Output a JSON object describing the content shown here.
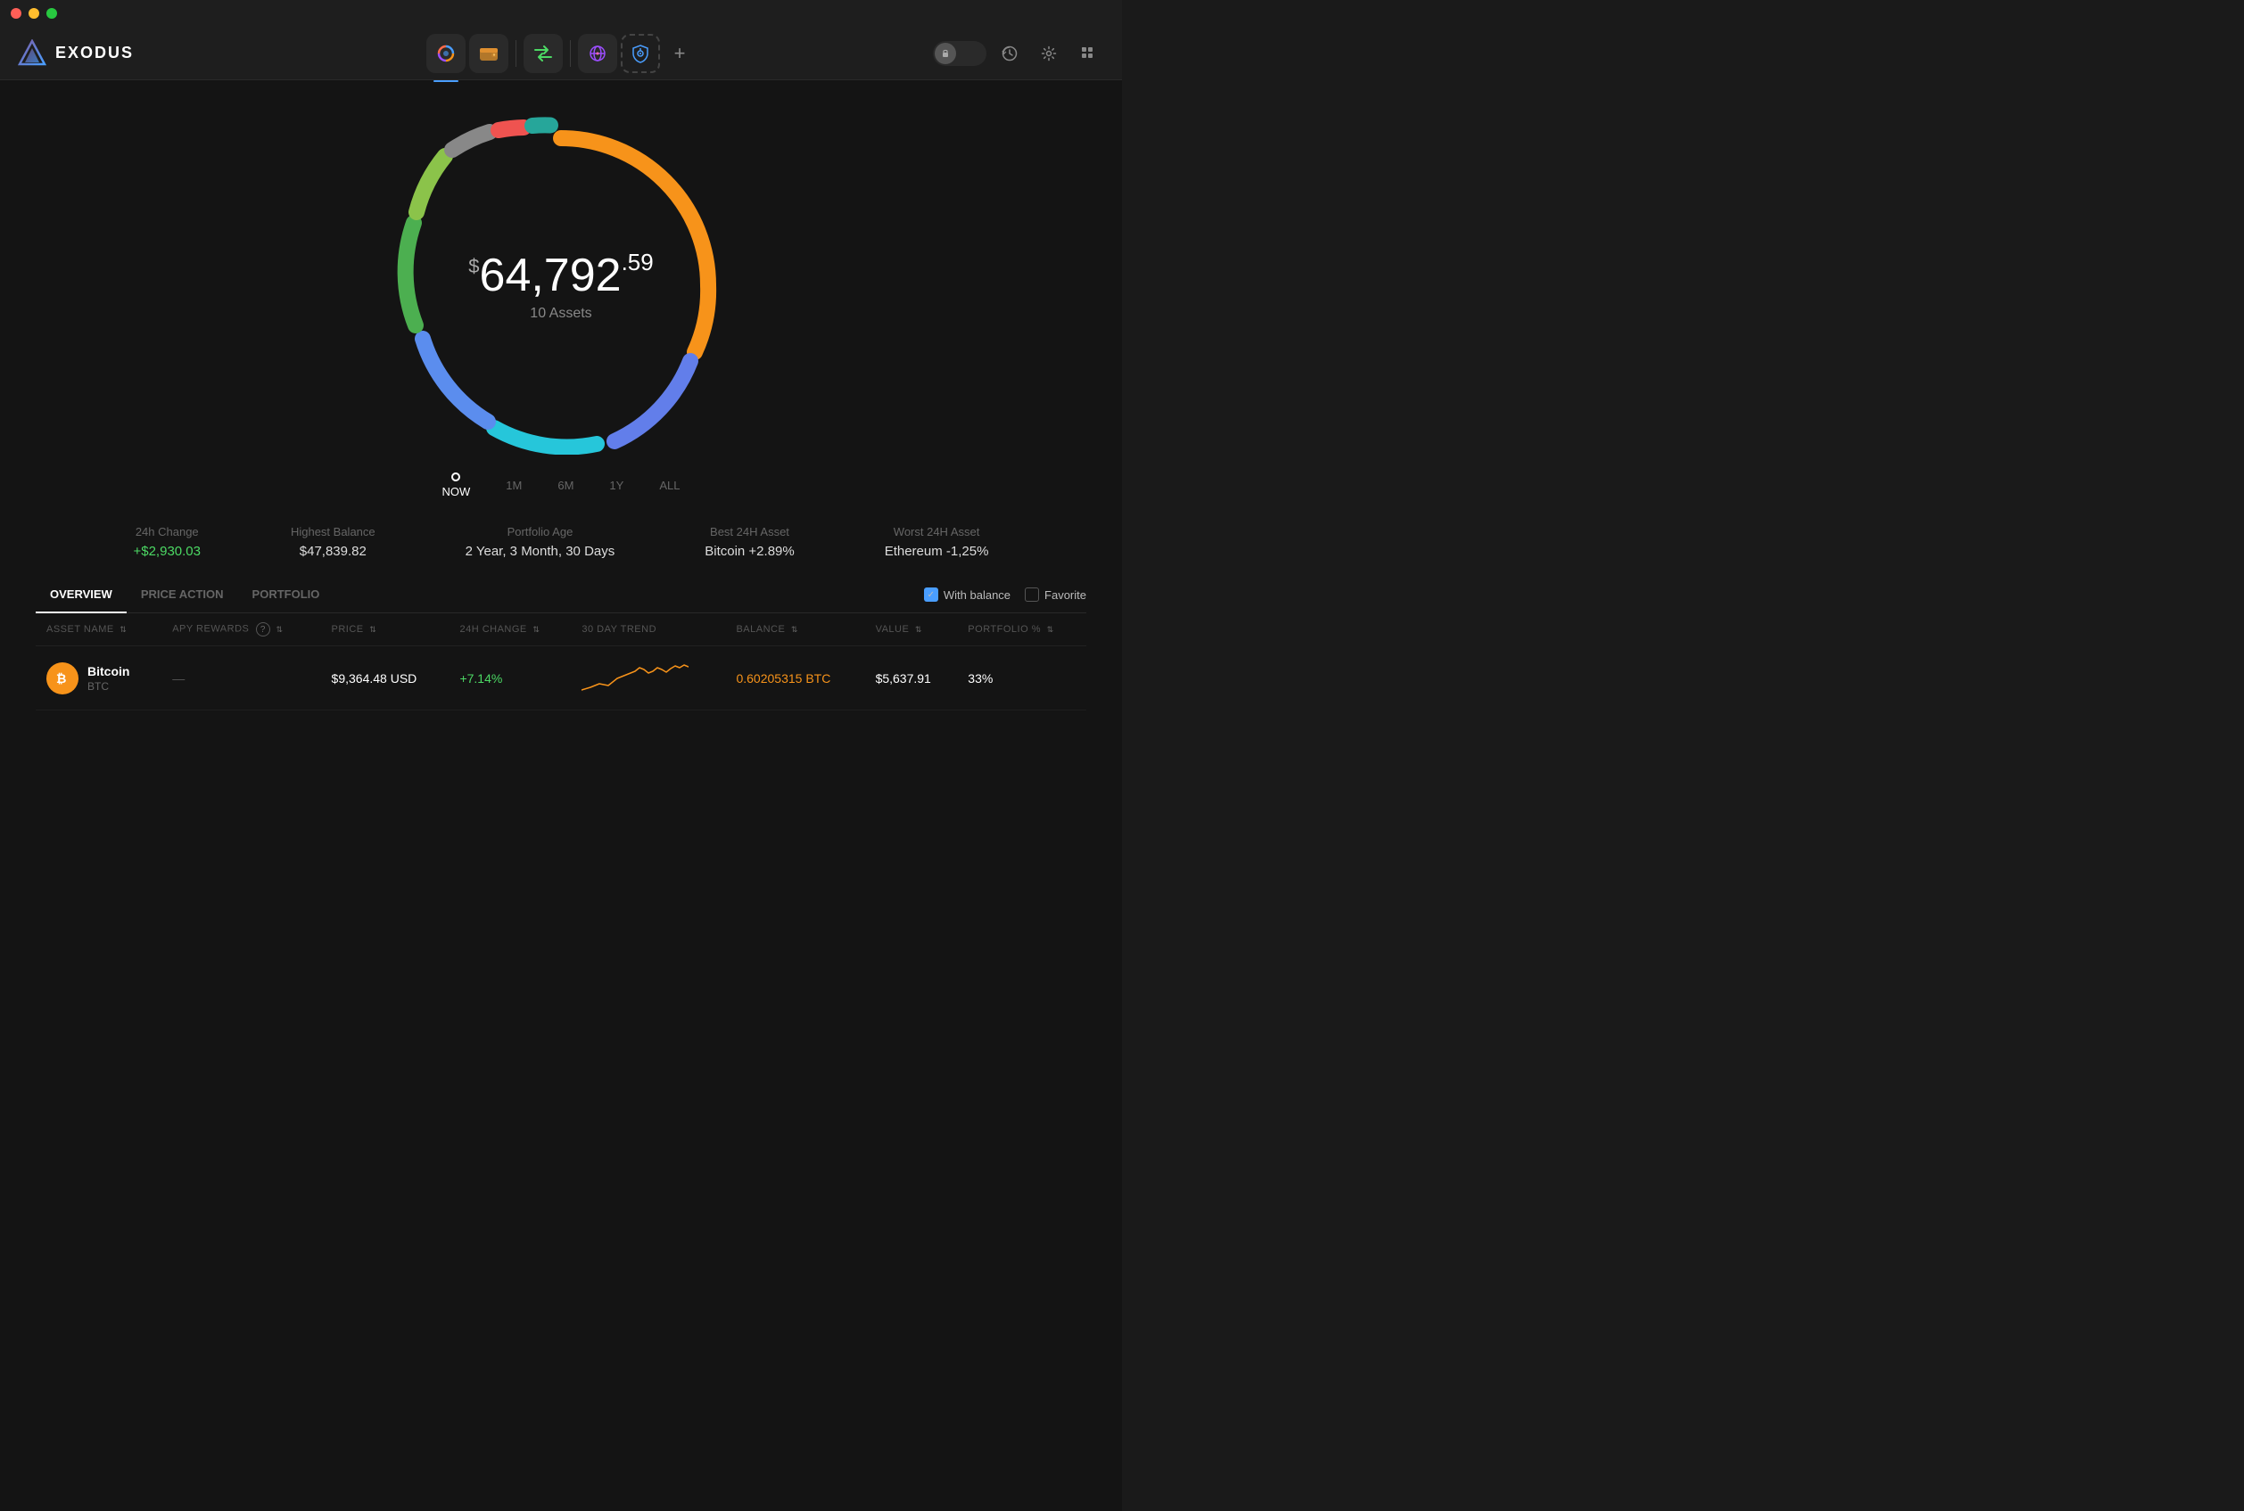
{
  "titleBar": {
    "trafficLights": [
      "red",
      "yellow",
      "green"
    ]
  },
  "header": {
    "logo": {
      "text": "EXODUS"
    },
    "navButtons": [
      {
        "id": "portfolio",
        "label": "Portfolio",
        "active": true,
        "icon": "⬤"
      },
      {
        "id": "wallet",
        "label": "Wallet",
        "active": false,
        "icon": "🟧"
      },
      {
        "id": "exchange",
        "label": "Exchange",
        "active": false,
        "icon": "⇄"
      },
      {
        "id": "apps",
        "label": "Apps",
        "active": false,
        "icon": "👾"
      },
      {
        "id": "earn",
        "label": "Earn",
        "active": false,
        "icon": "🛡"
      },
      {
        "id": "add",
        "label": "Add",
        "active": false,
        "icon": "+"
      }
    ],
    "rightButtons": [
      "lock",
      "history",
      "settings",
      "grid"
    ]
  },
  "portfolio": {
    "amountSymbol": "$",
    "amountMain": "64,792",
    "amountDecimal": ".59",
    "assetsCount": "10 Assets",
    "timeOptions": [
      "NOW",
      "1M",
      "6M",
      "1Y",
      "ALL"
    ]
  },
  "stats": [
    {
      "label": "24h Change",
      "value": "+$2,930.03",
      "positive": true
    },
    {
      "label": "Highest Balance",
      "value": "$47,839.82",
      "positive": false
    },
    {
      "label": "Portfolio Age",
      "value": "2 Year, 3 Month, 30 Days",
      "positive": false
    },
    {
      "label": "Best 24H Asset",
      "value": "Bitcoin +2.89%",
      "positive": false
    },
    {
      "label": "Worst 24H Asset",
      "value": "Ethereum -1,25%",
      "positive": false
    }
  ],
  "tabs": [
    {
      "id": "overview",
      "label": "OVERVIEW",
      "active": true
    },
    {
      "id": "price-action",
      "label": "PRICE ACTION",
      "active": false
    },
    {
      "id": "portfolio",
      "label": "PORTFOLIO",
      "active": false
    }
  ],
  "filters": {
    "withBalance": {
      "label": "With balance",
      "checked": true
    },
    "favorite": {
      "label": "Favorite",
      "checked": false
    }
  },
  "tableHeaders": [
    {
      "id": "asset-name",
      "label": "ASSET NAME",
      "sortable": true
    },
    {
      "id": "apy",
      "label": "APY REWARDS",
      "sortable": true,
      "hasHelp": true
    },
    {
      "id": "price",
      "label": "PRICE",
      "sortable": true
    },
    {
      "id": "change-24h",
      "label": "24H CHANGE",
      "sortable": true
    },
    {
      "id": "trend-30d",
      "label": "30 DAY TREND",
      "sortable": false
    },
    {
      "id": "balance",
      "label": "BALANCE",
      "sortable": true
    },
    {
      "id": "value",
      "label": "VALUE",
      "sortable": true
    },
    {
      "id": "portfolio-pct",
      "label": "PORTFOLIO %",
      "sortable": true
    }
  ],
  "assets": [
    {
      "name": "Bitcoin",
      "ticker": "BTC",
      "iconColor": "#f7931a",
      "iconText": "₿",
      "price": "$9,364.48 USD",
      "change24h": "+7.14%",
      "changePositive": true,
      "balance": "0.60205315 BTC",
      "value": "$5,637.91",
      "portfolioPct": "33%"
    }
  ],
  "ring": {
    "segments": [
      {
        "color": "#f7931a",
        "pct": 33,
        "startAngle": -90
      },
      {
        "color": "#627eea",
        "pct": 20
      },
      {
        "color": "#00bcd4",
        "pct": 12
      },
      {
        "color": "#9c27b0",
        "pct": 8
      },
      {
        "color": "#4caf50",
        "pct": 10
      },
      {
        "color": "#aaa",
        "pct": 5
      },
      {
        "color": "#e91e63",
        "pct": 3
      },
      {
        "color": "#ff5722",
        "pct": 4
      },
      {
        "color": "#8bc34a",
        "pct": 3
      },
      {
        "color": "#2196f3",
        "pct": 2
      }
    ]
  }
}
